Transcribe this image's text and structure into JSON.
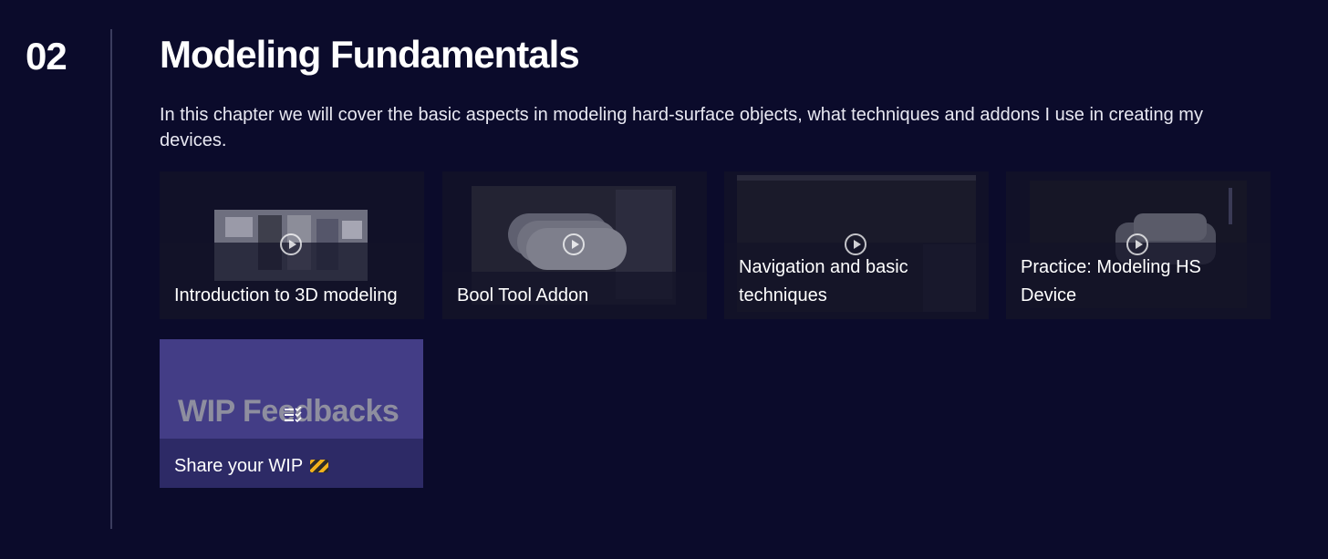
{
  "chapter": {
    "number": "02",
    "title": "Modeling Fundamentals",
    "description": "In this chapter we will cover the basic aspects in modeling hard-surface objects, what techniques and addons I use in creating my devices."
  },
  "lessons": [
    {
      "label": "Introduction to 3D modeling",
      "icon": "play-icon"
    },
    {
      "label": "Bool Tool Addon",
      "icon": "play-icon"
    },
    {
      "label": "Navigation and basic techniques",
      "icon": "play-icon"
    },
    {
      "label": "Practice: Modeling HS Device",
      "icon": "play-icon"
    }
  ],
  "wip": {
    "thumb_text": "WIP Feedbacks",
    "label": "Share your WIP",
    "icon": "construction-barrier-icon"
  },
  "colors": {
    "background": "#0b0b2b",
    "wip_card": "#433d86",
    "wip_footer": "#2d2a66"
  }
}
